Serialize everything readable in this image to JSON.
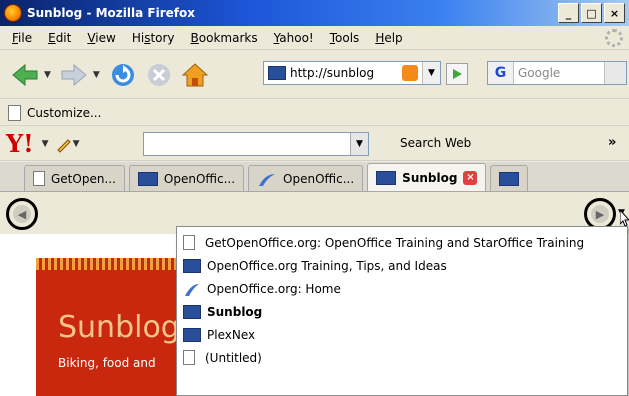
{
  "window": {
    "title": "Sunblog - Mozilla Firefox",
    "controls": [
      "_",
      "□",
      "×"
    ]
  },
  "menubar": {
    "items": [
      {
        "label": "File",
        "accel": "F",
        "rest": "ile"
      },
      {
        "label": "Edit",
        "accel": "E",
        "rest": "dit"
      },
      {
        "label": "View",
        "accel": "V",
        "rest": "iew"
      },
      {
        "label": "History",
        "accel": "",
        "pre": "Hi",
        "accelMid": "s",
        "rest": "tory"
      },
      {
        "label": "Bookmarks",
        "accel": "B",
        "rest": "ookmarks"
      },
      {
        "label": "Yahoo!",
        "accel": "Y",
        "rest": "ahoo!"
      },
      {
        "label": "Tools",
        "accel": "T",
        "rest": "ools"
      },
      {
        "label": "Help",
        "accel": "H",
        "rest": "elp"
      }
    ]
  },
  "navbar": {
    "url": "http://sunblog",
    "search_placeholder": "Google"
  },
  "bookmarks": {
    "customize_label": "Customize..."
  },
  "yahoo": {
    "search_label": "Search Web",
    "more": "»"
  },
  "tabs": [
    {
      "label": "GetOpen...",
      "icon": "page-icon",
      "active": false
    },
    {
      "label": "OpenOffic...",
      "icon": "openoffice-icon",
      "active": false
    },
    {
      "label": "OpenOffic...",
      "icon": "ooo-bird-icon",
      "active": false
    },
    {
      "label": "Sunblog",
      "icon": "openoffice-icon",
      "active": true
    }
  ],
  "tab_list_menu": {
    "items": [
      {
        "label": "GetOpenOffice.org: OpenOffice Training and StarOffice Training",
        "icon": "page-icon",
        "bold": false
      },
      {
        "label": "OpenOffice.org Training, Tips, and Ideas",
        "icon": "openoffice-icon",
        "bold": false
      },
      {
        "label": "OpenOffice.org: Home",
        "icon": "ooo-bird-icon",
        "bold": false
      },
      {
        "label": "Sunblog",
        "icon": "openoffice-icon",
        "bold": true
      },
      {
        "label": "PlexNex",
        "icon": "openoffice-icon",
        "bold": false
      },
      {
        "label": "(Untitled)",
        "icon": "page-icon",
        "bold": false
      }
    ]
  },
  "page": {
    "blog_title": "Sunblog",
    "blog_subtitle": "Biking, food and"
  },
  "colors": {
    "banner_red": "#c9280e",
    "title_bar_blue": "#1d56d8"
  }
}
